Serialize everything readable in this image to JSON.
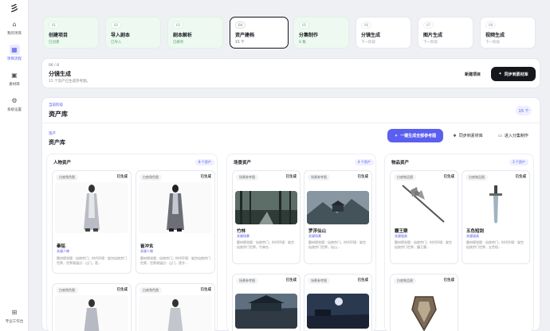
{
  "nav": [
    {
      "label": "我的项目",
      "icon": "home-icon"
    },
    {
      "label": "项目流程",
      "icon": "grid-icon"
    },
    {
      "label": "素材库",
      "icon": "image-icon"
    },
    {
      "label": "系统设置",
      "icon": "settings-icon"
    }
  ],
  "nav_bottom": "专业工作台",
  "steps": [
    {
      "num": "01",
      "name": "创建项目",
      "status": "已创建",
      "state": "done"
    },
    {
      "num": "02",
      "name": "导入剧本",
      "status": "已导入",
      "state": "done"
    },
    {
      "num": "03",
      "name": "剧本解析",
      "status": "已解析",
      "state": "done"
    },
    {
      "num": "04",
      "name": "资产建档",
      "status": "15 个",
      "state": "current"
    },
    {
      "num": "05",
      "name": "分集制作",
      "status": "8 集",
      "state": "done"
    },
    {
      "num": "06",
      "name": "分镜生成",
      "status": "下一阶段",
      "state": "todo"
    },
    {
      "num": "07",
      "name": "图片生成",
      "status": "下一阶段",
      "state": "todo"
    },
    {
      "num": "08",
      "name": "视频生成",
      "status": "下一阶段",
      "state": "todo"
    }
  ],
  "step_panel": {
    "count": "06 / 8",
    "title": "分镜生成",
    "desc": "15 个资产已生成参考图。",
    "new_btn": "新建项目",
    "sync_btn": "同步到素材库"
  },
  "stage": {
    "label": "当前阶段",
    "title": "资产库",
    "count": "15 个"
  },
  "assets": {
    "label": "资产",
    "title": "资产库",
    "gen_btn": "一键生成全部参考图",
    "sync_btn": "同步到素材库",
    "enter_btn": "进入分集制作"
  },
  "columns": [
    {
      "title": "人物资产",
      "count": "8 个资产",
      "tag": "白底角色图"
    },
    {
      "title": "场景资产",
      "count": "4 个资产",
      "tag": "场景参考图"
    },
    {
      "title": "物品资产",
      "count": "3 个资产",
      "tag": "白底物品图"
    }
  ],
  "status": "已生成",
  "cards": [
    {
      "name": "秦铭",
      "role": "关键人物",
      "desc": "题材视觉版：仙侠宗门；时代环境：架空仙侠宗门世界，世界观锚点：山门，莲..."
    },
    {
      "name": "崔冲玄",
      "role": "关键人物",
      "desc": "题材视觉版：仙侠宗门；时代环境：架空仙侠宗门世界，世界观锚点：山门，莲字..."
    },
    {
      "name": "竹林",
      "role": "关键场景",
      "desc": "题材视觉版：仙侠宗门；时代环境：架空仙侠宗门世界，竹林在..."
    },
    {
      "name": "罗浮仙山",
      "role": "关键场景",
      "desc": "题材视觉版：仙侠宗门；时代环境：架空仙侠宗门世界，仙山..."
    },
    {
      "name": "霸王槊",
      "role": "关键道具",
      "desc": "题材视觉版：仙侠宗门；时代环境：架空仙侠宗门世界，霸王槊..."
    },
    {
      "name": "五色短剑",
      "role": "关键道具",
      "desc": "题材视觉版：仙侠宗门；时代环境：架空仙侠宗门世界，五色短..."
    }
  ]
}
